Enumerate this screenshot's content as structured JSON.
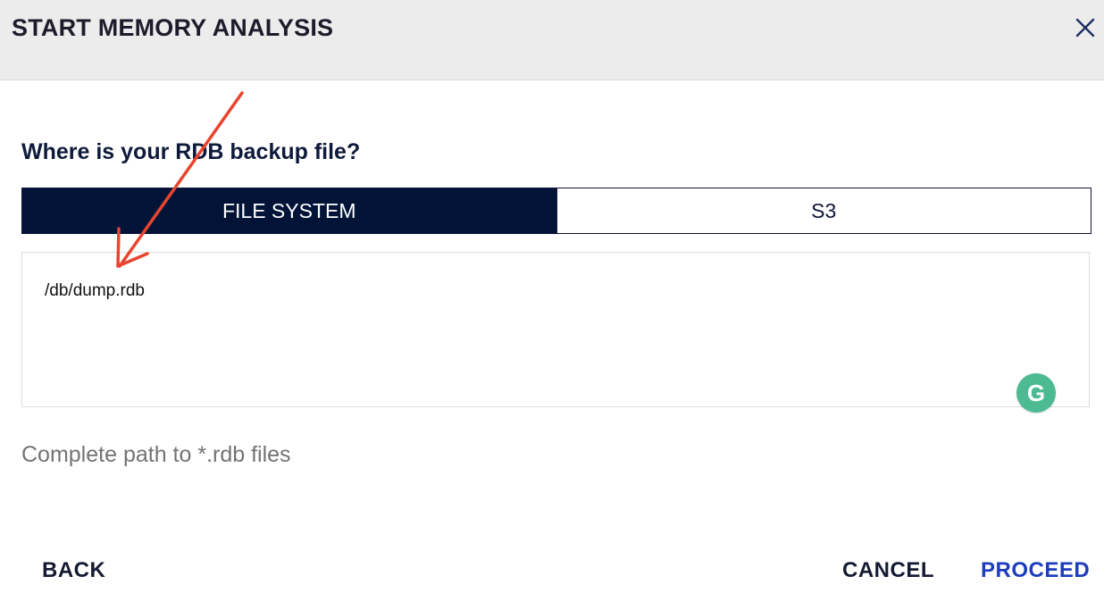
{
  "dialog": {
    "title": "START MEMORY ANALYSIS",
    "close_icon": "close-icon"
  },
  "question": "Where is your RDB backup file?",
  "tabs": [
    {
      "label": "FILE SYSTEM",
      "active": true
    },
    {
      "label": "S3",
      "active": false
    }
  ],
  "path_field": {
    "value": "/db/dump.rdb"
  },
  "grammarly": {
    "icon": "grammarly-icon",
    "glyph": "G"
  },
  "hint": "Complete path to *.rdb files",
  "footer": {
    "back_label": "BACK",
    "cancel_label": "CANCEL",
    "proceed_label": "PROCEED"
  },
  "colors": {
    "header_bg": "#ececec",
    "active_tab": "#011438",
    "proceed": "#1d3dbd",
    "grammarly": "#4cbb93",
    "annotation_arrow": "#e8452f"
  }
}
